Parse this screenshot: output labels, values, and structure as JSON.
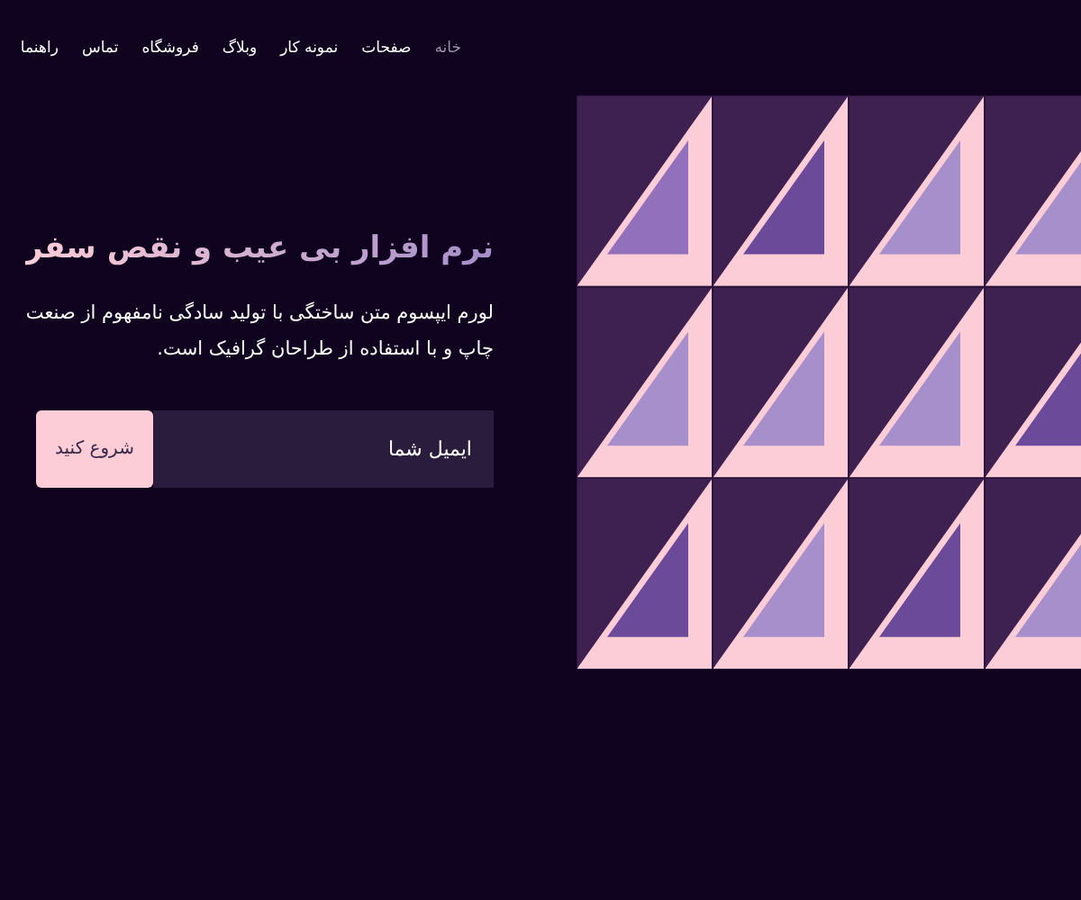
{
  "nav": [
    {
      "label": "خانه",
      "selected": true
    },
    {
      "label": "صفحات",
      "selected": false
    },
    {
      "label": "نمونه کار",
      "selected": false
    },
    {
      "label": "وبلاگ",
      "selected": false
    },
    {
      "label": "فروشگاه",
      "selected": false
    },
    {
      "label": "تماس",
      "selected": false
    },
    {
      "label": "راهنما",
      "selected": false
    }
  ],
  "hero": {
    "title": "نرم افزار بی عیب و نقص سفر",
    "text": "لورم ایپسوم متن ساختگی با تولید سادگی نامفهوم از صنعت چاپ و با استفاده از طراحان گرافیک است.",
    "email": {
      "placeholder": "ایمیل شما"
    },
    "button": "شروع کنید"
  }
}
